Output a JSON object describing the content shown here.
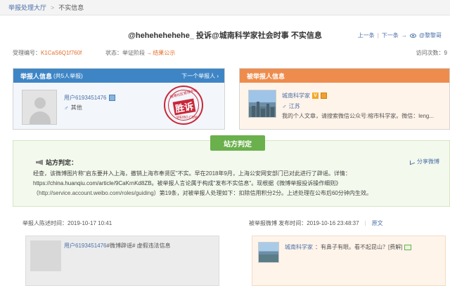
{
  "breadcrumb": {
    "home": "举报处理大厅",
    "current": "不实信息"
  },
  "header": {
    "title": "@hehehehehehe_ 投诉@城南科学家社会时事 不实信息",
    "prev": "上一条",
    "next": "下一条",
    "next_user": "@黎黎哥"
  },
  "meta": {
    "case_label": "受理编号：",
    "case_id": "K1CaS6Q1f760f",
    "status_label": "状态：",
    "status_stage": "举证阶段",
    "status_result": "结果公示",
    "visits": "访问次数：9"
  },
  "reporter": {
    "heading": "举报人信息",
    "count": "(共5人举报)",
    "next": "下一个举报人",
    "name": "用户6193451476",
    "location": "其他",
    "stamp": {
      "ring": "微博社区管理中心",
      "main": "胜诉",
      "bottom": "WEIBO.COM"
    }
  },
  "reported": {
    "heading": "被举报人信息",
    "name": "城南科学家",
    "verified_mark": "V",
    "location": "江苏",
    "bio": "我的个人文章，请搜索微信公众号:榕市科学家。微信：leng..."
  },
  "verdict": {
    "tab": "站方判定",
    "label": "站方判定：",
    "share": "分享微博",
    "text_a": "经查，该微博图片称\"启东要并入上海，撤销上海市奉贤区\"不实。早在2018年9月，上海公安网安部门已对此进行了辟谣。详情：https://china.huanqiu.com/article/9CaKrnKd8ZB。被举报人言论属于构成\"发布不实信息\"。现根据《微博举报投诉操作细则》（",
    "text_link": "http://service.account.weibo.com/roles/guiding",
    "text_b": "）第19条，对被举报人处理如下：扣除信用积分2分。上述处理在公布后60分钟内生效。"
  },
  "complaint": {
    "label": "举报人陈述时间：",
    "time": "2019-10-17 10:41",
    "user": "用户6193451476",
    "content": "#微博辟谣# 虚假违法信息"
  },
  "reported_post": {
    "label": "被举报微博 发布时间：",
    "time": "2019-10-16 23:48:37",
    "original": "原文",
    "user": "城南科学家",
    "content": "：有鼻子有眼。看不起昆山？[费解]"
  }
}
